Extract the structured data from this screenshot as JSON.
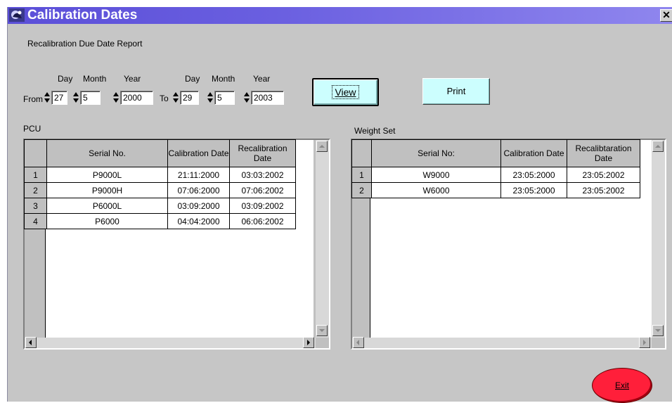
{
  "window": {
    "title": "Calibration Dates",
    "close_glyph": "✕"
  },
  "report": {
    "subtitle": "Recalibration Due Date Report"
  },
  "date_range": {
    "from_label": "From",
    "to_label": "To",
    "headers": {
      "day": "Day",
      "month": "Month",
      "year": "Year"
    },
    "from": {
      "day": "27",
      "month": "5",
      "year": "2000"
    },
    "to": {
      "day": "29",
      "month": "5",
      "year": "2003"
    }
  },
  "buttons": {
    "view": "View",
    "print": "Print",
    "exit": "Exit"
  },
  "pcu": {
    "label": "PCU",
    "columns": [
      "Serial No.",
      "Calibration Date",
      "Recalibration Date"
    ],
    "rows": [
      {
        "n": "1",
        "serial": "P9000L",
        "cal": "21:11:2000",
        "recal": "03:03:2002"
      },
      {
        "n": "2",
        "serial": "P9000H",
        "cal": "07:06:2000",
        "recal": "07:06:2002"
      },
      {
        "n": "3",
        "serial": "P6000L",
        "cal": "03:09:2000",
        "recal": "03:09:2002"
      },
      {
        "n": "4",
        "serial": "P6000",
        "cal": "04:04:2000",
        "recal": "06:06:2002"
      }
    ]
  },
  "weight": {
    "label": "Weight Set",
    "columns": [
      "Serial No:",
      "Calibration Date",
      "Recalibtaration Date"
    ],
    "rows": [
      {
        "n": "1",
        "serial": "W9000",
        "cal": "23:05:2000",
        "recal": "23:05:2002"
      },
      {
        "n": "2",
        "serial": "W6000",
        "cal": "23:05:2000",
        "recal": "23:05:2002"
      }
    ]
  },
  "colors": {
    "title_bar": "#5b4fd8",
    "button_bg": "#ccfefe",
    "exit_bg": "#ff1f3a",
    "window_bg": "#c6c6c6"
  }
}
